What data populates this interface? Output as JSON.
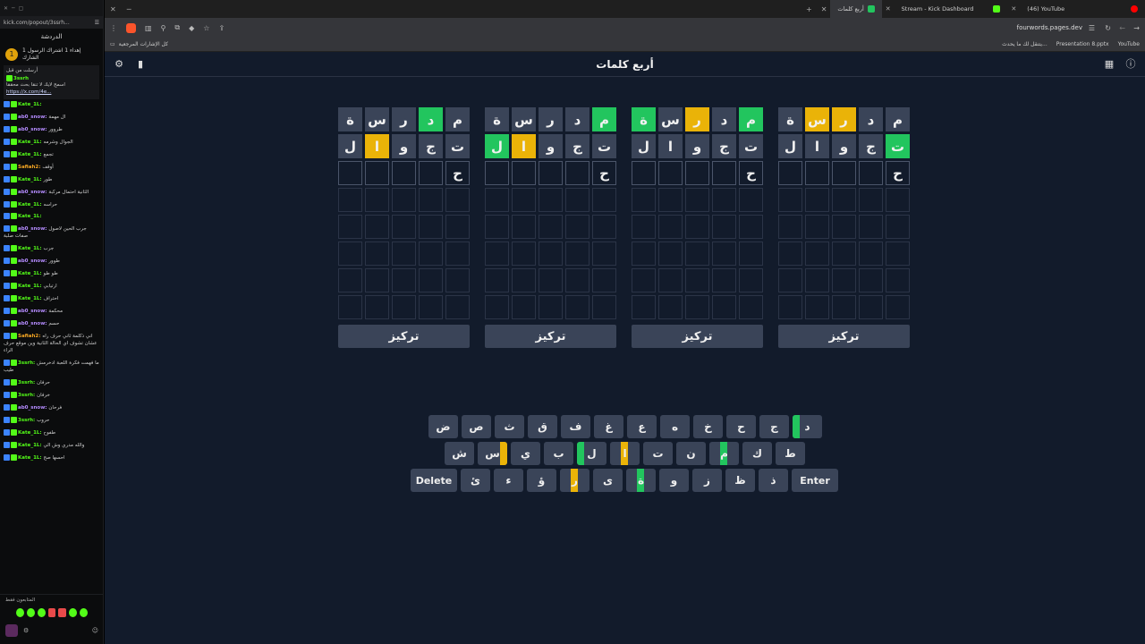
{
  "chat": {
    "window_url": "kick.com/popout/3ssrh...",
    "title": "الدردشة",
    "pinned": {
      "rank": "1",
      "text": "إهداء 1 اشتراك الرسول 1 الشارك"
    },
    "pinbox": {
      "line1": "أرسلت من قبل",
      "user": "3ssrh",
      "line2": "اسمح لايك لا تنقا بحث محققا",
      "link": "https://x.com/4e..."
    },
    "messages": [
      {
        "user": "Kate_1L",
        "text": "",
        "color": "#53fc18"
      },
      {
        "user": "ab0_snow",
        "text": "ال مهمة",
        "color": "#b58cff"
      },
      {
        "user": "ab0_snow",
        "text": "طروور",
        "color": "#b58cff"
      },
      {
        "user": "Kate_1L",
        "text": "الجوال وشرمه",
        "color": "#53fc18"
      },
      {
        "user": "Kate_1L",
        "text": "تجمع",
        "color": "#53fc18"
      },
      {
        "user": "Safiah2",
        "text": "أوقف",
        "color": "#f5a623"
      },
      {
        "user": "Kate_1L",
        "text": "طور",
        "color": "#53fc18"
      },
      {
        "user": "ab0_snow",
        "text": "الثانية احتمال مركبة",
        "color": "#b58cff"
      },
      {
        "user": "Kate_1L",
        "text": "حراسه",
        "color": "#53fc18"
      },
      {
        "user": "Kate_1L",
        "text": "",
        "color": "#53fc18"
      },
      {
        "user": "ab0_snow",
        "text": "جرب الحين لاصول صفات صلبة",
        "color": "#b58cff"
      },
      {
        "user": "Kate_1L",
        "text": "جرب",
        "color": "#53fc18"
      },
      {
        "user": "ab0_snow",
        "text": "طوور",
        "color": "#b58cff"
      },
      {
        "user": "Kate_1L",
        "text": "طو طو",
        "color": "#53fc18"
      },
      {
        "user": "Kate_1L",
        "text": "ارتيابي",
        "color": "#53fc18"
      },
      {
        "user": "Kate_1L",
        "text": "احتراف",
        "color": "#53fc18"
      },
      {
        "user": "ab0_snow",
        "text": "محكمة",
        "color": "#b58cff"
      },
      {
        "user": "ab0_snow",
        "text": "حسم",
        "color": "#b58cff"
      },
      {
        "user": "Safiah2",
        "text": "اني ذكلمة ثاني حرف راه عشان تشوف اي الحالة الثانية وين موقع حرف الراء",
        "color": "#f5a623"
      },
      {
        "user": "3ssrh",
        "text": "ما فهمت فكرة اللعبة ادخرمش طيب",
        "color": "#53fc18"
      },
      {
        "user": "3ssrh",
        "text": "حرفان",
        "color": "#53fc18"
      },
      {
        "user": "3ssrh",
        "text": "خرفان",
        "color": "#53fc18"
      },
      {
        "user": "ab0_snow",
        "text": "فرحان",
        "color": "#b58cff"
      },
      {
        "user": "3ssrh",
        "text": "حروب",
        "color": "#53fc18"
      },
      {
        "user": "Kate_1L",
        "text": "طفوح",
        "color": "#53fc18"
      },
      {
        "user": "Kate_1L",
        "text": "والله مدري وش الي",
        "color": "#53fc18"
      },
      {
        "user": "Kate_1L",
        "text": "احسها صح",
        "color": "#53fc18"
      }
    ],
    "sending_label": "المتابعون فقط"
  },
  "browser": {
    "tabs": [
      {
        "label": "أربع كلمات",
        "active": true,
        "fav": "#22c55e"
      },
      {
        "label": "Stream - Kick Dashboard",
        "active": false,
        "fav": "#53fc18"
      },
      {
        "label": "(46) YouTube",
        "active": false,
        "fav": "#ff0000"
      }
    ],
    "address": "fourwords.pages.dev",
    "bookmarks_left": "كل الإشارات المرجعية",
    "bookmarks_right": [
      "يتنقل لك ما يحدث...",
      "Presentation 8.pptx",
      "YouTube"
    ]
  },
  "game": {
    "title": "أربع كلمات",
    "focus_label": "تركيز",
    "colors": {
      "correct": "#22c55e",
      "present": "#eab308",
      "absent": "#3a4458",
      "bg": "#121b2b"
    },
    "boards": [
      {
        "rows": [
          {
            "letters": [
              "ة",
              "س",
              "ر",
              "د",
              "م"
            ],
            "states": [
              "a",
              "a",
              "a",
              "g",
              "a"
            ]
          },
          {
            "letters": [
              "ل",
              "ا",
              "و",
              "ج",
              "ت"
            ],
            "states": [
              "a",
              "y",
              "a",
              "a",
              "a"
            ]
          },
          {
            "letters": [
              "",
              "",
              "",
              "",
              "ح"
            ],
            "states": [
              "t",
              "t",
              "t",
              "t",
              "t"
            ]
          }
        ]
      },
      {
        "rows": [
          {
            "letters": [
              "ة",
              "س",
              "ر",
              "د",
              "م"
            ],
            "states": [
              "a",
              "a",
              "a",
              "a",
              "g"
            ]
          },
          {
            "letters": [
              "ل",
              "ا",
              "و",
              "ج",
              "ت"
            ],
            "states": [
              "g",
              "y",
              "a",
              "a",
              "a"
            ]
          },
          {
            "letters": [
              "",
              "",
              "",
              "",
              "ح"
            ],
            "states": [
              "t",
              "t",
              "t",
              "t",
              "t"
            ]
          }
        ]
      },
      {
        "rows": [
          {
            "letters": [
              "ة",
              "س",
              "ر",
              "د",
              "م"
            ],
            "states": [
              "g",
              "a",
              "y",
              "a",
              "g"
            ]
          },
          {
            "letters": [
              "ل",
              "ا",
              "و",
              "ج",
              "ت"
            ],
            "states": [
              "a",
              "a",
              "a",
              "a",
              "a"
            ]
          },
          {
            "letters": [
              "",
              "",
              "",
              "",
              "ح"
            ],
            "states": [
              "t",
              "t",
              "t",
              "t",
              "t"
            ]
          }
        ]
      },
      {
        "rows": [
          {
            "letters": [
              "ة",
              "س",
              "ر",
              "د",
              "م"
            ],
            "states": [
              "a",
              "y",
              "y",
              "a",
              "a"
            ]
          },
          {
            "letters": [
              "ل",
              "ا",
              "و",
              "ج",
              "ت"
            ],
            "states": [
              "a",
              "a",
              "a",
              "a",
              "g"
            ]
          },
          {
            "letters": [
              "",
              "",
              "",
              "",
              "ح"
            ],
            "states": [
              "t",
              "t",
              "t",
              "t",
              "t"
            ]
          }
        ]
      }
    ],
    "keyboard": {
      "row1": [
        {
          "k": "ض"
        },
        {
          "k": "ص"
        },
        {
          "k": "ث"
        },
        {
          "k": "ق"
        },
        {
          "k": "ف"
        },
        {
          "k": "غ"
        },
        {
          "k": "ع"
        },
        {
          "k": "ه"
        },
        {
          "k": "خ"
        },
        {
          "k": "ح"
        },
        {
          "k": "ج"
        },
        {
          "k": "د",
          "marks": [
            [
              "g",
              "left"
            ]
          ]
        }
      ],
      "row2": [
        {
          "k": "ش"
        },
        {
          "k": "س",
          "marks": [
            [
              "y",
              "right"
            ]
          ]
        },
        {
          "k": "ي"
        },
        {
          "k": "ب"
        },
        {
          "k": "ل",
          "marks": [
            [
              "g",
              "left"
            ]
          ]
        },
        {
          "k": "ا",
          "marks": [
            [
              "y",
              "mid"
            ]
          ]
        },
        {
          "k": "ت"
        },
        {
          "k": "ن"
        },
        {
          "k": "م",
          "marks": [
            [
              "g",
              "mid"
            ]
          ]
        },
        {
          "k": "ك"
        },
        {
          "k": "ط"
        }
      ],
      "row3": [
        {
          "k": "Delete",
          "wide": true
        },
        {
          "k": "ئ"
        },
        {
          "k": "ء"
        },
        {
          "k": "ؤ"
        },
        {
          "k": "ر",
          "marks": [
            [
              "y",
              "mid"
            ]
          ]
        },
        {
          "k": "ى"
        },
        {
          "k": "ة",
          "marks": [
            [
              "g",
              "mid"
            ]
          ]
        },
        {
          "k": "و"
        },
        {
          "k": "ز"
        },
        {
          "k": "ظ"
        },
        {
          "k": "ذ"
        },
        {
          "k": "Enter",
          "wide": true
        }
      ]
    }
  }
}
